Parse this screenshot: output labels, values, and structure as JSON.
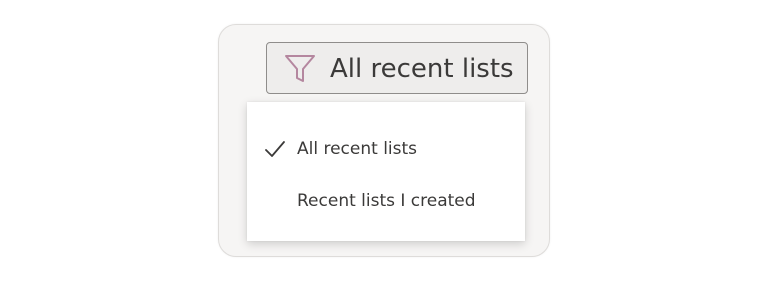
{
  "filter_button": {
    "label": "All recent lists",
    "icon": "funnel-icon"
  },
  "dropdown": {
    "items": [
      {
        "label": "All recent lists",
        "selected": true,
        "icon": "checkmark-icon"
      },
      {
        "label": "Recent lists I created",
        "selected": false
      }
    ]
  },
  "colors": {
    "panel_background": "#f6f5f4",
    "button_background": "#eeedec",
    "funnel_icon": "#b4879f",
    "text": "#3b3a39"
  }
}
